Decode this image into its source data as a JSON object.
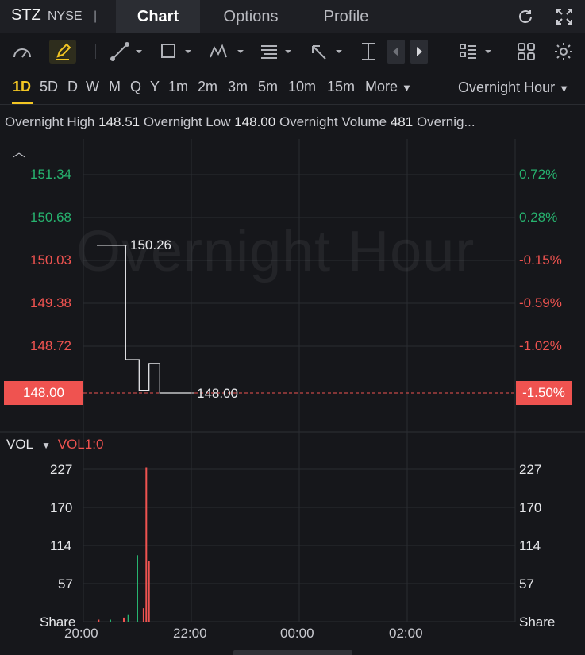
{
  "header": {
    "ticker": "STZ",
    "exchange": "NYSE",
    "separator": "|",
    "tabs": [
      "Chart",
      "Options",
      "Profile"
    ],
    "active_tab": "Chart"
  },
  "toolbar": {
    "icons": [
      "speedometer-icon",
      "pencil-icon",
      "line-tool-icon",
      "rectangle-tool-icon",
      "pattern-tool-icon",
      "fibonacci-tool-icon",
      "arrow-tool-icon",
      "measure-tool-icon",
      "prev-icon",
      "next-icon",
      "layout-list-icon",
      "grid-icon",
      "settings-icon"
    ]
  },
  "timeframes": {
    "items": [
      "1D",
      "5D",
      "D",
      "W",
      "M",
      "Q",
      "Y",
      "1m",
      "2m",
      "3m",
      "5m",
      "10m",
      "15m"
    ],
    "active": "1D",
    "more_label": "More",
    "session_label": "Overnight Hour"
  },
  "info_bar": {
    "high_label": "Overnight High",
    "high_value": "148.51",
    "low_label": "Overnight Low",
    "low_value": "148.00",
    "volume_label": "Overnight Volume",
    "volume_value": "481",
    "trailing": "Overnig..."
  },
  "price_panel": {
    "watermark": "Overnight Hour",
    "left_ticks": [
      "151.34",
      "150.68",
      "150.03",
      "149.38",
      "148.72"
    ],
    "right_ticks": [
      "0.72%",
      "0.28%",
      "-0.15%",
      "-0.59%",
      "-1.02%"
    ],
    "current_price": "148.00",
    "current_pct": "-1.50%",
    "high_marker": "150.26",
    "last_marker": "148.00",
    "colors": {
      "up": "#27b36f",
      "down": "#ef5350",
      "line": "#e6e7ea"
    }
  },
  "volume_panel": {
    "label": "VOL",
    "indicator": "VOL1:0",
    "left_ticks": [
      "227",
      "170",
      "114",
      "57",
      "Share"
    ],
    "right_ticks": [
      "227",
      "170",
      "114",
      "57",
      "Share"
    ]
  },
  "x_axis": [
    "20:00",
    "22:00",
    "00:00",
    "02:00"
  ],
  "chart_data": {
    "type": "line",
    "price_series": {
      "time": [
        "20:15",
        "20:17",
        "20:47",
        "20:50",
        "21:02",
        "21:05",
        "21:13",
        "21:16",
        "21:25",
        "22:00"
      ],
      "values": [
        150.26,
        150.26,
        148.51,
        148.51,
        148.04,
        148.04,
        148.45,
        148.45,
        148.0,
        148.0
      ]
    },
    "volume_series": {
      "time": [
        "20:17",
        "20:30",
        "20:45",
        "20:50",
        "21:00",
        "21:07",
        "21:10",
        "21:13"
      ],
      "values": [
        3,
        3,
        6,
        11,
        99,
        20,
        230,
        90
      ],
      "colors": [
        "#ef5350",
        "#27b36f",
        "#ef5350",
        "#27b36f",
        "#27b36f",
        "#ef5350",
        "#ef5350",
        "#ef5350"
      ]
    },
    "ylim": [
      147.8,
      151.6
    ],
    "vol_ylim": [
      0,
      250
    ]
  }
}
